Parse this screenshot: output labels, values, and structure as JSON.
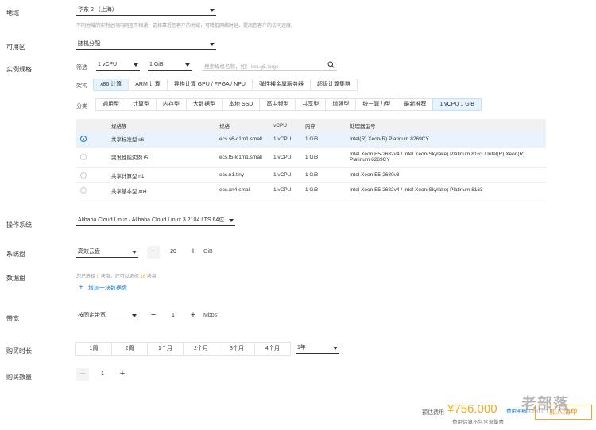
{
  "region": {
    "label": "地域",
    "value": "华东 2 （上海）",
    "hint": "不同地域的实例之间内网互不相通；选择靠近您客户的地域，可降低网络时延、提高您客户的访问速度。"
  },
  "zone": {
    "label": "可用区",
    "value": "随机分配"
  },
  "instance": {
    "label": "实例规格",
    "filter_label": "筛选",
    "vcpu": "1 vCPU",
    "mem": "1 GiB",
    "search_placeholder": "搜索规格名称，如：ecs.g5.large",
    "arch_label": "架构",
    "arch": [
      "x86 计算",
      "ARM 计算",
      "异构计算 GPU / FPGA / NPU",
      "弹性裸金属服务器",
      "超级计算集群"
    ],
    "cat_label": "分类",
    "cats": [
      "通用型",
      "计算型",
      "内存型",
      "大数据型",
      "本地 SSD",
      "高主频型",
      "共享型",
      "增强型",
      "统一算力型",
      "最新推荐",
      "1 vCPU 1 GiB"
    ],
    "columns": [
      "规格族",
      "规格",
      "vCPU",
      "内存",
      "处理器型号"
    ],
    "rows": [
      {
        "family": "共享标准型 s6",
        "spec": "ecs.s6-c1m1.small",
        "vcpu": "1 vCPU",
        "mem": "1 GiB",
        "cpu": "Intel(R) Xeon(R) Platinum 8269CY",
        "selected": true
      },
      {
        "family": "突发性能实例 t5",
        "spec": "ecs.t5-lc1m1.small",
        "vcpu": "1 vCPU",
        "mem": "1 GiB",
        "cpu": "Intel Xeon E5-2682v4 / Intel Xeon(Skylake) Platinum 8163 / Intel(R) Xeon(R) Platinum 8269CY",
        "selected": false
      },
      {
        "family": "共享计算型 n1",
        "spec": "ecs.n1.tiny",
        "vcpu": "1 vCPU",
        "mem": "1 GiB",
        "cpu": "Intel Xeon E5-2680v3",
        "selected": false
      },
      {
        "family": "共享基本型 xn4",
        "spec": "ecs.xn4.small",
        "vcpu": "1 vCPU",
        "mem": "1 GiB",
        "cpu": "Intel Xeon E5-2682v4 / Intel Xeon(Skylake) Platinum 8163",
        "selected": false
      }
    ]
  },
  "os": {
    "label": "操作系统",
    "value": "Alibaba Cloud Linux / Alibaba Cloud Linux 3.2104 LTS 64位"
  },
  "sysdisk": {
    "label": "系统盘",
    "type": "高效云盘",
    "size": "20",
    "unit": "GiB"
  },
  "datadisk": {
    "label": "数据盘",
    "hint_a": "您已选择",
    "hint_count": "0",
    "hint_b": "块盘，还可以选择",
    "hint_remain": "16",
    "hint_c": "块盘",
    "add": "增加一块数据盘"
  },
  "bandwidth": {
    "label": "带宽",
    "type": "按固定带宽",
    "value": "1",
    "unit": "Mbps"
  },
  "duration": {
    "label": "购买时长",
    "options": [
      "1周",
      "2周",
      "1个月",
      "2个月",
      "3个月",
      "4个月"
    ],
    "select": "1年"
  },
  "quantity": {
    "label": "购买数量",
    "value": "1"
  },
  "footer": {
    "fee_label": "预估费用",
    "price": "¥756.000",
    "detail": "费用明细",
    "note": "费用估算不包含流量费",
    "add_btn": "加入清单"
  },
  "watermark": {
    "cn": "老部落",
    "en": "LAOBULUO.COM"
  },
  "colors": {
    "accent": "#1677d2",
    "price": "#f5a623",
    "selected_bg": "#e5f3ff"
  }
}
